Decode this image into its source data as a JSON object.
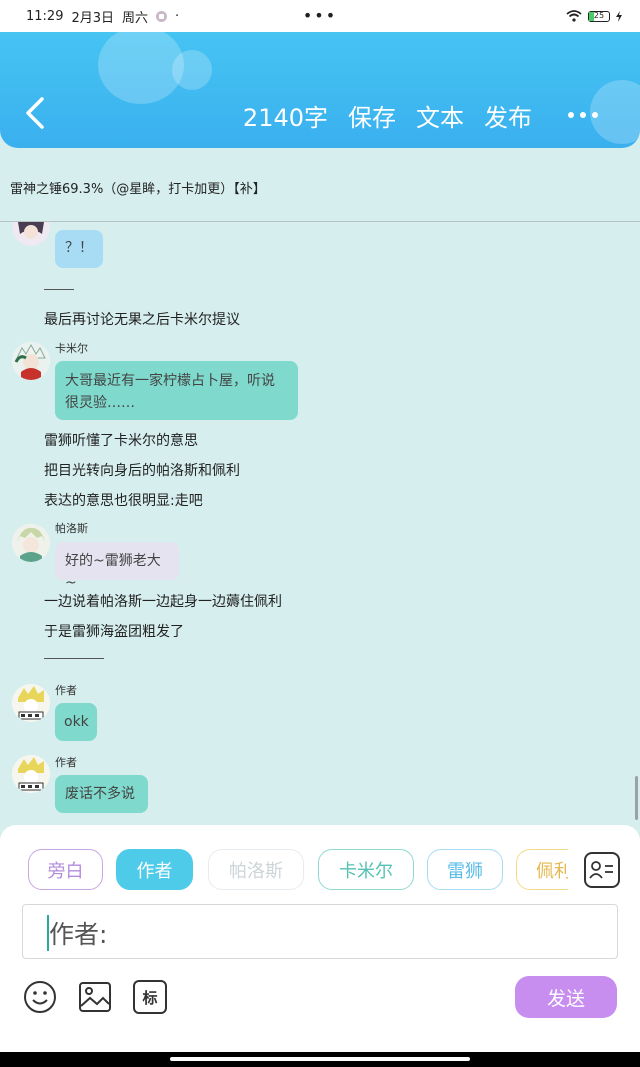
{
  "status_bar": {
    "time": "11:29",
    "date": "2月3日",
    "weekday": "周六",
    "center_dots": "•••",
    "battery": "25"
  },
  "header": {
    "word_count": "2140字",
    "save": "保存",
    "text": "文本",
    "publish": "发布"
  },
  "chapter_title": "雷神之锤69.3%（@星眸，打卡加更）【补】",
  "chat": {
    "msg1": {
      "text": "？！"
    },
    "narr1": "最后再讨论无果之后卡米尔提议",
    "msg2": {
      "name": "卡米尔",
      "line1": "大哥最近有一家柠檬占卜屋，听说",
      "line2": "很灵验……"
    },
    "narr2": "雷狮听懂了卡米尔的意思",
    "narr3": "把目光转向身后的帕洛斯和佩利",
    "narr4": "表达的意思也很明显:走吧",
    "msg3": {
      "name": "帕洛斯",
      "text": "好的~雷狮老大~"
    },
    "narr5": "一边说着帕洛斯一边起身一边薅住佩利",
    "narr6": "于是雷狮海盗团粗发了",
    "msg4": {
      "name": "作者",
      "text": "okk"
    },
    "msg5": {
      "name": "作者",
      "text": "废话不多说"
    }
  },
  "roles": [
    "旁白",
    "作者",
    "帕洛斯",
    "卡米尔",
    "雷狮",
    "佩利"
  ],
  "input": {
    "prefix": "作者:"
  },
  "toolbar": {
    "tag_label": "标",
    "send": "发送"
  },
  "colors": {
    "header": "#3ab0ef",
    "background": "#d6eeee",
    "bubble_blue": "#a8dcf5",
    "bubble_teal": "#7fd9cc",
    "bubble_lilac": "#e6e3f0",
    "send": "#c78ef0"
  }
}
